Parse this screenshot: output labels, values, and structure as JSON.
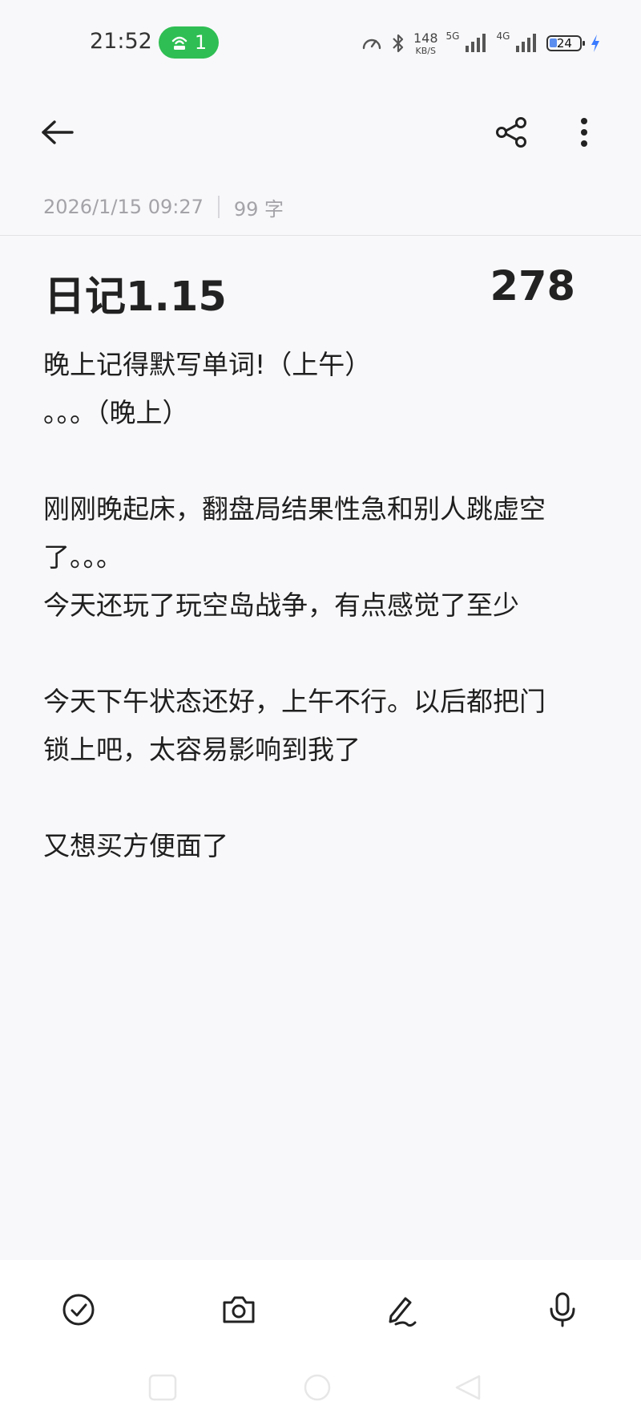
{
  "status_bar": {
    "time": "21:52",
    "hotspot_count": "1",
    "net_speed_value": "148",
    "net_speed_unit": "KB/S",
    "signal1_label": "5G",
    "signal2_label": "4G",
    "battery_level": "24",
    "colors": {
      "hotspot": "#2fbe53",
      "battery_fill": "#5b8def",
      "charging": "#3a7bff"
    }
  },
  "toolbar": {
    "back_icon": "arrow-left-icon",
    "share_icon": "share-icon",
    "more_icon": "more-vertical-icon"
  },
  "meta": {
    "datetime": "2026/1/15 09:27",
    "word_count": "99 字"
  },
  "note": {
    "title": "日记1.15",
    "count": "278",
    "lines": [
      "晚上记得默写单词!（上午）",
      "。。。（晚上）",
      "",
      "刚刚晚起床，翻盘局结果性急和别人跳虚空",
      "了。。。",
      "今天还玩了玩空岛战争，有点感觉了至少",
      "",
      "今天下午状态还好，上午不行。以后都把门",
      "锁上吧，太容易影响到我了",
      "",
      "又想买方便面了"
    ]
  },
  "bottom_toolbar": {
    "items": [
      "checklist-icon",
      "camera-icon",
      "handwriting-icon",
      "microphone-icon"
    ]
  }
}
